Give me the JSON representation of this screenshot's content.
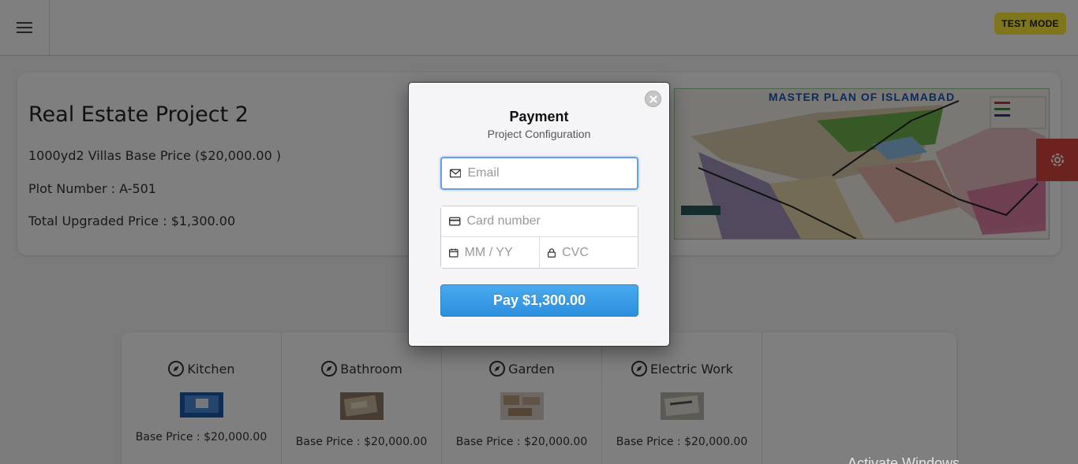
{
  "header": {
    "menu_icon": "hamburger-icon",
    "test_mode_label": "TEST MODE"
  },
  "project": {
    "title": "Real Estate Project 2",
    "base_price_line": "1000yd2 Villas Base Price ($20,000.00 )",
    "plot_number_line": "Plot Number : A-501",
    "total_price_line": "Total Upgraded Price : $1,300.00",
    "map_title": "MASTER PLAN OF ISLAMABAD"
  },
  "settings_icon": "gear-icon",
  "features": [
    {
      "name": "Kitchen",
      "price": "Base Price : $20,000.00",
      "icon": "compass-icon"
    },
    {
      "name": "Bathroom",
      "price": "Base Price : $20,000.00",
      "icon": "compass-icon"
    },
    {
      "name": "Garden",
      "price": "Base Price : $20,000.00",
      "icon": "compass-icon"
    },
    {
      "name": "Electric Work",
      "price": "Base Price : $20,000.00",
      "icon": "compass-icon"
    }
  ],
  "watermark": "Activate Windows",
  "modal": {
    "title": "Payment",
    "subtitle": "Project Configuration",
    "close_icon": "close-icon",
    "email_placeholder": "Email",
    "card_number_placeholder": "Card number",
    "expiry_placeholder": "MM / YY",
    "cvc_placeholder": "CVC",
    "pay_label": "Pay $1,300.00"
  },
  "colors": {
    "test_mode_bg": "#ffeb3b",
    "pay_button": "#3a9de6",
    "settings_tab": "#d9453c",
    "email_focus_border": "#6b9ee8"
  }
}
